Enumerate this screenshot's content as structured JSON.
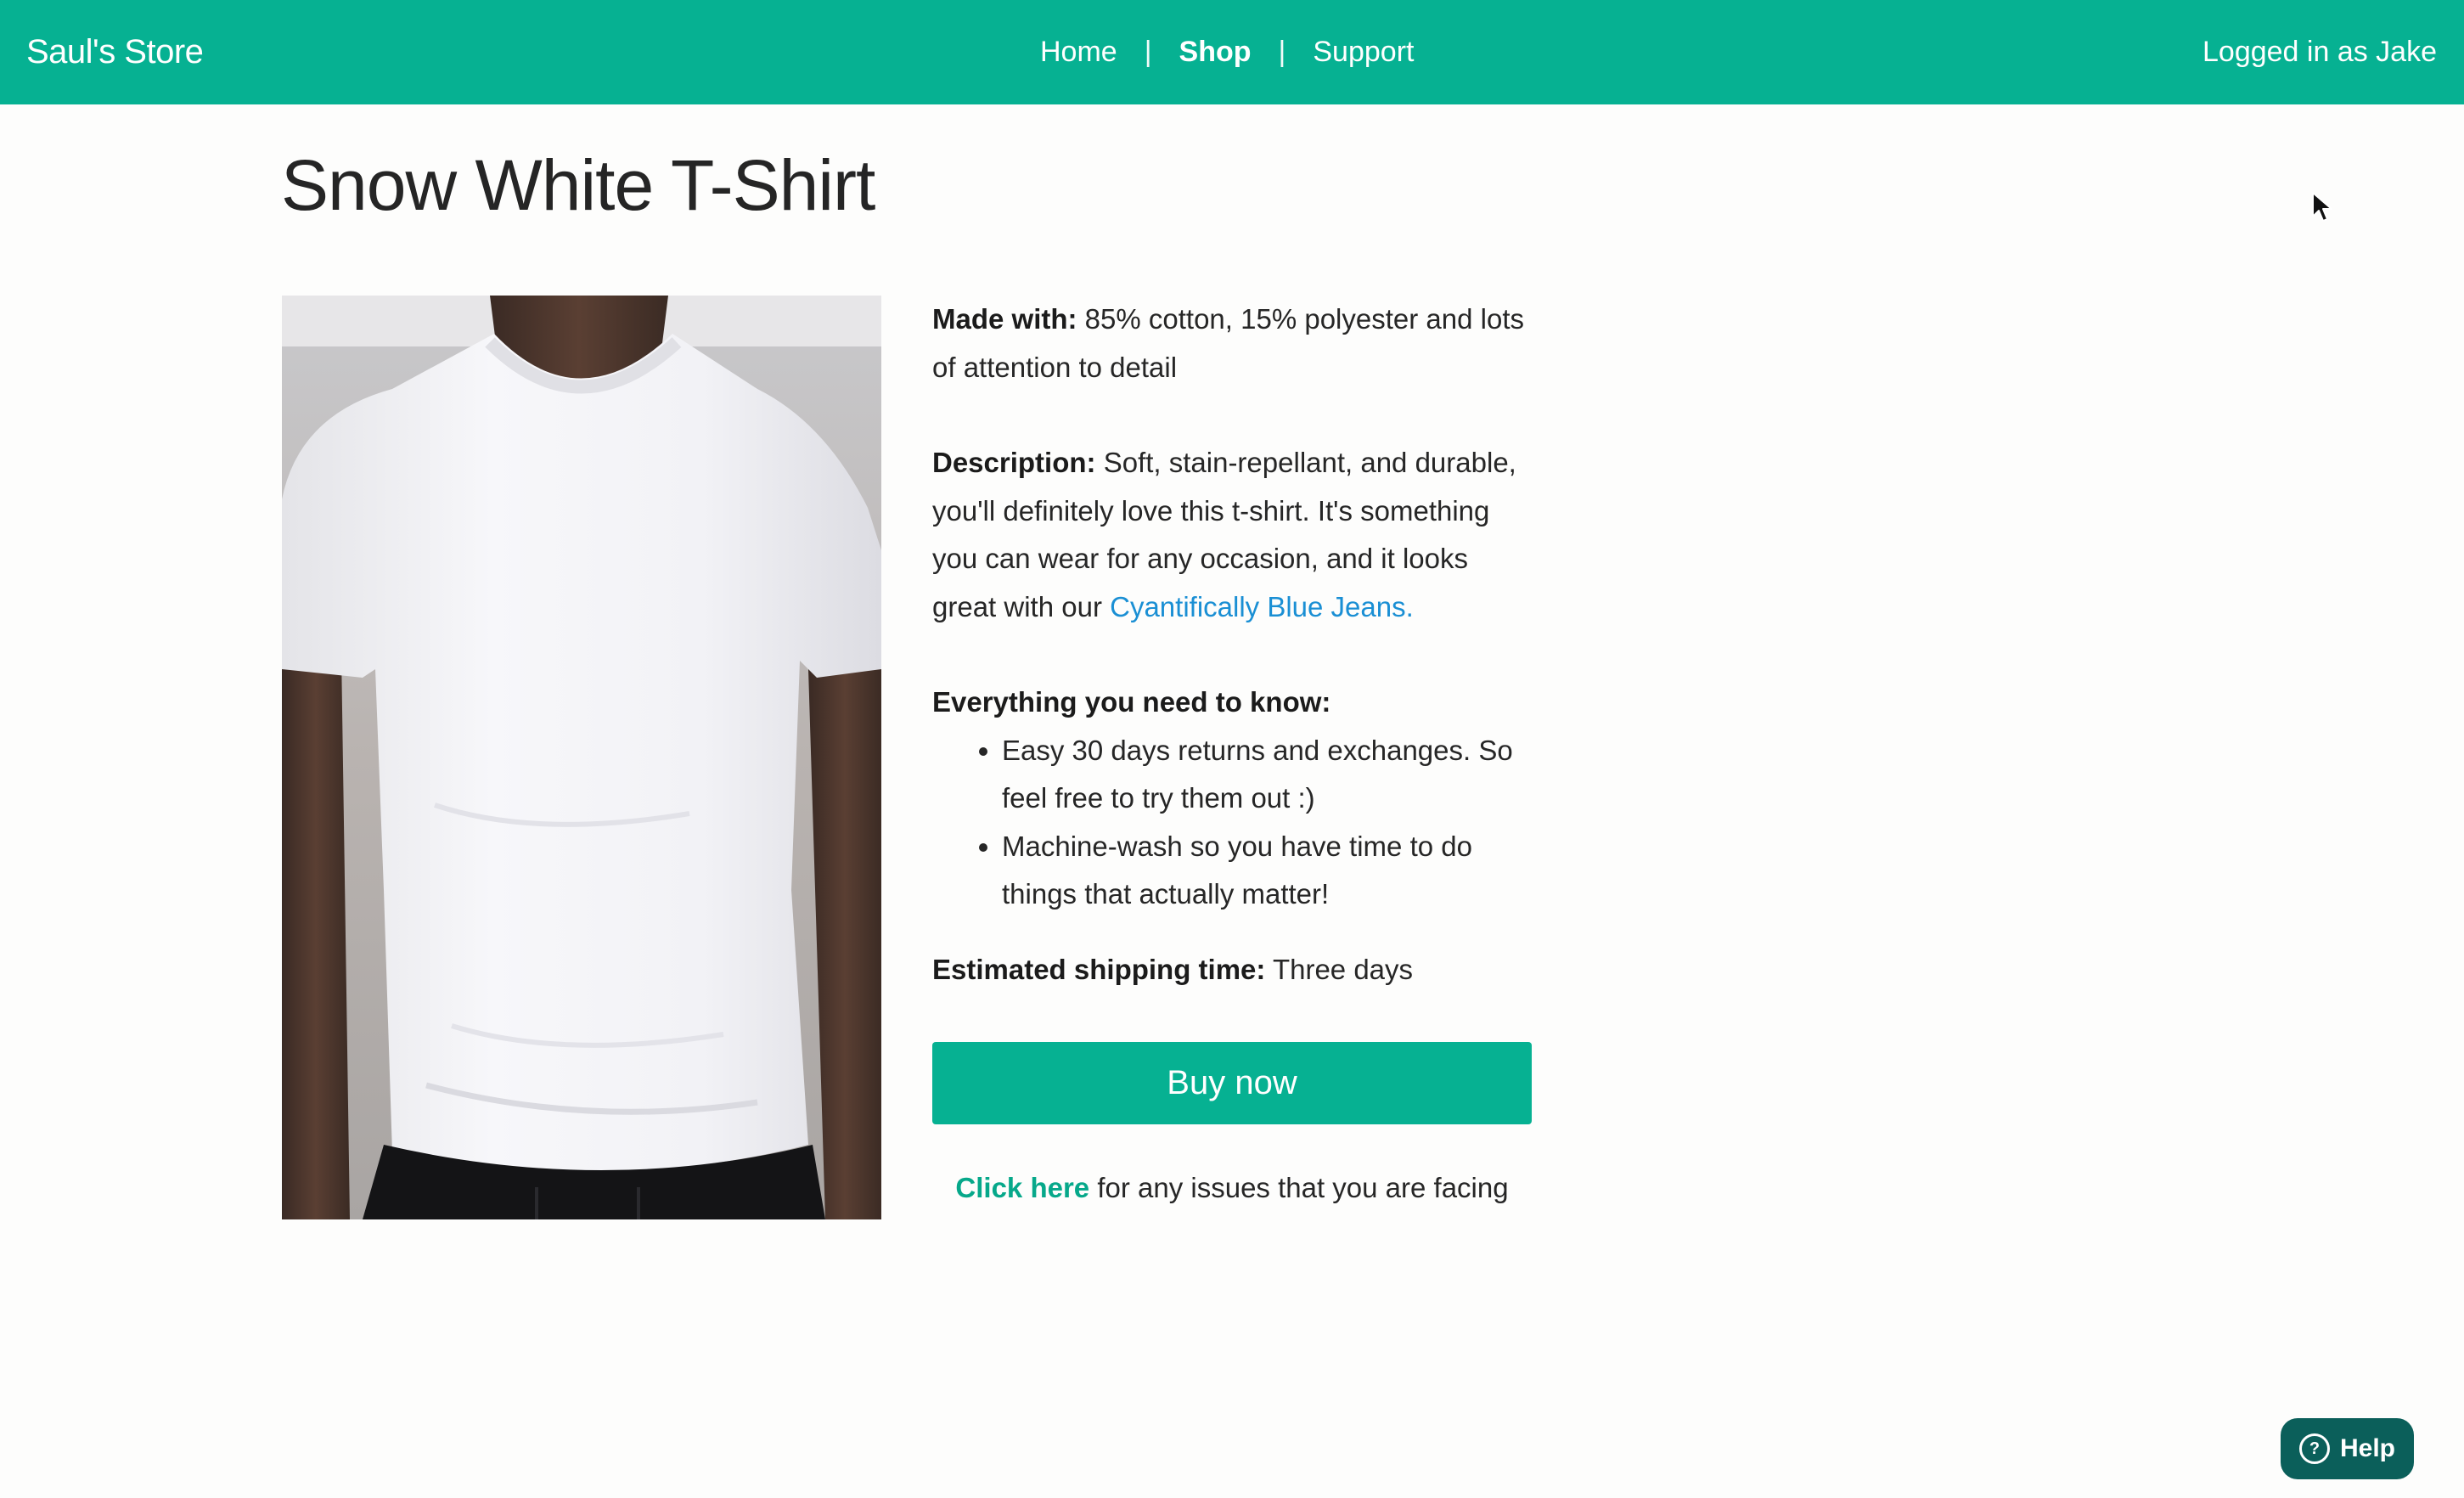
{
  "header": {
    "brand": "Saul's Store",
    "nav": {
      "home": "Home",
      "separator": "|",
      "shop": "Shop",
      "support": "Support"
    },
    "user_status": "Logged in as Jake"
  },
  "product": {
    "title": "Snow White T-Shirt",
    "made_with_label": "Made with:",
    "made_with_value": " 85% cotton, 15% polyester and lots of attention to detail",
    "description_label": "Description:",
    "description_text": " Soft, stain-repellant, and durable, you'll definitely love this t-shirt. It's something you can wear for any occasion, and it looks great with our ",
    "description_link": "Cyantifically Blue Jeans.",
    "know_heading": "Everything you need to know:",
    "bullets": [
      "Easy 30 days returns and exchanges. So feel free to try them out :)",
      "Machine-wash so you have time to do things that actually matter!"
    ],
    "shipping_label": "Estimated shipping time:",
    "shipping_value": " Three days",
    "buy_label": "Buy now",
    "issue_link": "Click here",
    "issue_text": " for any issues that you are facing"
  },
  "help": {
    "icon_glyph": "?",
    "label": "Help"
  },
  "colors": {
    "brand": "#06b192",
    "link": "#1a8fd4",
    "help_bg": "#0b5f5a"
  },
  "icons": [
    "question-circle-icon",
    "mouse-cursor-icon"
  ]
}
